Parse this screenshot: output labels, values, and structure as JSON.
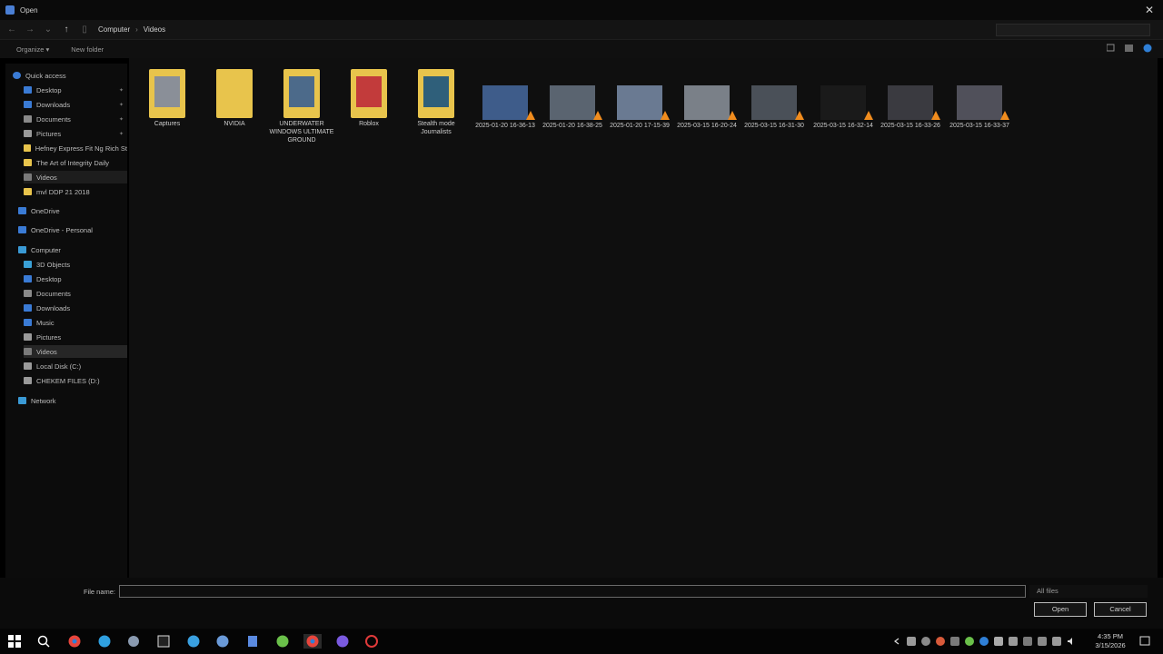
{
  "window": {
    "title": "Open"
  },
  "address": {
    "crumbs": [
      "Computer",
      "Videos"
    ]
  },
  "toolbar": {
    "organize_label": "Organize ▾",
    "new_folder_label": "New folder"
  },
  "navpane": {
    "quick_access_label": "Quick access",
    "quick_items": [
      {
        "label": "Desktop",
        "icon": "desktop-icon",
        "color": "#3a7bd5"
      },
      {
        "label": "Downloads",
        "icon": "downloads-icon",
        "color": "#3a7bd5"
      },
      {
        "label": "Documents",
        "icon": "documents-icon",
        "color": "#8a8a8a"
      },
      {
        "label": "Pictures",
        "icon": "pictures-icon",
        "color": "#9a9a9a"
      },
      {
        "label": "Hefney Express Fit Ng Rich St",
        "icon": "folder-icon",
        "color": "#e8c44c"
      },
      {
        "label": "The Art of Integrity Daily",
        "icon": "folder-icon",
        "color": "#e8c44c"
      },
      {
        "label": "Videos",
        "icon": "videos-icon",
        "color": "#7a7a7a"
      },
      {
        "label": "mvl DDP 21 2018",
        "icon": "folder-icon",
        "color": "#e8c44c"
      }
    ],
    "onedrive_label": "OneDrive",
    "onedrive_personal_label": "OneDrive - Personal",
    "computer_label": "Computer",
    "computer_items": [
      {
        "label": "3D Objects",
        "icon": "3d-objects-icon",
        "color": "#3aa0d5"
      },
      {
        "label": "Desktop",
        "icon": "desktop-icon",
        "color": "#3a7bd5"
      },
      {
        "label": "Documents",
        "icon": "documents-icon",
        "color": "#8a8a8a"
      },
      {
        "label": "Downloads",
        "icon": "downloads-icon",
        "color": "#3a7bd5"
      },
      {
        "label": "Music",
        "icon": "music-icon",
        "color": "#3a7bd5"
      },
      {
        "label": "Pictures",
        "icon": "pictures-icon",
        "color": "#9a9a9a"
      },
      {
        "label": "Videos",
        "icon": "videos-icon",
        "color": "#7a7a7a"
      },
      {
        "label": "Local Disk (C:)",
        "icon": "drive-icon",
        "color": "#9a9a9a"
      },
      {
        "label": "CHEKEM FILES (D:)",
        "icon": "drive-icon",
        "color": "#9a9a9a"
      }
    ],
    "network_label": "Network"
  },
  "files": [
    {
      "label": "Captures",
      "kind": "folder",
      "photo": "#8a8f98"
    },
    {
      "label": "NVIDIA",
      "kind": "folder",
      "photo": "#e8c44c"
    },
    {
      "label": "UNDERWATER WINDOWS ULTIMATE GROUND",
      "kind": "folder",
      "photo": "#4c6a8a"
    },
    {
      "label": "Roblox",
      "kind": "folder",
      "photo": "#c23b3b"
    },
    {
      "label": "Stealth mode Journalists",
      "kind": "folder",
      "photo": "#2f5f7a"
    },
    {
      "label": "2025-01-20 16-36-13",
      "kind": "video",
      "photo": "#3e5c8a"
    },
    {
      "label": "2025-01-20 16-38-25",
      "kind": "video",
      "photo": "#5a6470"
    },
    {
      "label": "2025-01-20 17-15-39",
      "kind": "video",
      "photo": "#6a7a92"
    },
    {
      "label": "2025-03-15 16-20-24",
      "kind": "video",
      "photo": "#7a8088"
    },
    {
      "label": "2025-03-15 16-31-30",
      "kind": "video",
      "photo": "#4a5058"
    },
    {
      "label": "2025-03-15 16-32-14",
      "kind": "video",
      "photo": "#1a1a1a"
    },
    {
      "label": "2025-03-15 16-33-26",
      "kind": "video",
      "photo": "#3a3a40"
    },
    {
      "label": "2025-03-15 16-33-37",
      "kind": "video",
      "photo": "#50505a"
    }
  ],
  "bottom": {
    "file_name_label": "File name:",
    "file_name_value": "",
    "filter_label": "All files",
    "open_label": "Open",
    "cancel_label": "Cancel"
  },
  "taskbar": {
    "apps": [
      {
        "name": "windows-start-icon",
        "color": "#ffffff"
      },
      {
        "name": "search-icon",
        "color": "#ffffff"
      },
      {
        "name": "chrome-icon",
        "color": "#e8453c"
      },
      {
        "name": "edge-icon",
        "color": "#2fa0e0"
      },
      {
        "name": "app-icon",
        "color": "#8a9ab0"
      },
      {
        "name": "capcut-icon",
        "color": "#d8d8d8"
      },
      {
        "name": "telegram-icon",
        "color": "#3aa0e0"
      },
      {
        "name": "steam-icon",
        "color": "#6a9ad8"
      },
      {
        "name": "calculator-icon",
        "color": "#5a8ae0"
      },
      {
        "name": "utorrent-icon",
        "color": "#6ac04a"
      },
      {
        "name": "chrome-active-icon",
        "color": "#e8453c"
      },
      {
        "name": "app2-icon",
        "color": "#7a5ae0"
      },
      {
        "name": "recorder-icon",
        "color": "#e03a3a"
      }
    ],
    "time": "4:35 PM",
    "date": "3/15/2026"
  }
}
